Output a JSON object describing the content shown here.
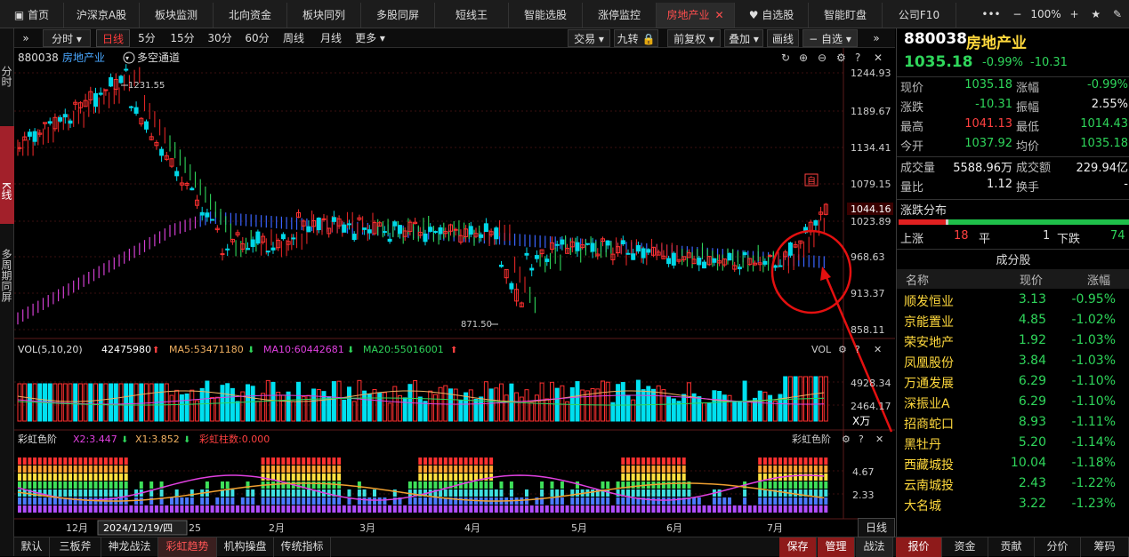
{
  "nav": {
    "tabs": [
      "首页",
      "沪深京A股",
      "板块监测",
      "北向资金",
      "板块同列",
      "多股同屏",
      "短线王",
      "智能选股",
      "涨停监控",
      "房地产业",
      "自选股",
      "智能盯盘",
      "公司F10"
    ],
    "active": "房地产业",
    "zoom": "100%"
  },
  "left_bar": {
    "items": [
      "分时",
      "K线",
      "多周期同屏"
    ]
  },
  "toolbar": {
    "left": [
      "分时",
      "日线",
      "5分",
      "15分",
      "30分",
      "60分",
      "周线",
      "月线",
      "更多"
    ],
    "active": "日线",
    "right": [
      "交易",
      "九转",
      "前复权",
      "叠加",
      "画线",
      "自选"
    ]
  },
  "chart_header": {
    "code": "880038",
    "name": "房地产业",
    "indicator": "多空通道"
  },
  "price_axis": [
    "1244.93",
    "1189.67",
    "1134.41",
    "1079.15",
    "1023.89",
    "968.63",
    "913.37",
    "858.11"
  ],
  "current_price_tag": "1044.16",
  "annotations": {
    "high": "1231.55",
    "low": "871.50",
    "marker": "自"
  },
  "volume": {
    "title": "VOL(5,10,20)",
    "value": "42475980",
    "ma5": "MA5:53471180",
    "ma10": "MA10:60442681",
    "ma20": "MA20:55016001",
    "label": "VOL",
    "axis": [
      "4928.34",
      "2464.17"
    ],
    "unit": "X万"
  },
  "rainbow": {
    "title": "彩虹色阶",
    "x2": "X2:3.447",
    "x1": "X1:3.852",
    "count": "彩虹柱数:0.000",
    "label": "彩虹色阶",
    "axis": [
      "4.67",
      "2.33"
    ]
  },
  "x_axis": {
    "labels": [
      "12月",
      "2月",
      "3月",
      "4月",
      "5月",
      "6月",
      "7月"
    ],
    "cursor": "2024/12/19/四",
    "cursor_tail": "25"
  },
  "bottom_tabs": [
    "默认",
    "三板斧",
    "神龙战法",
    "彩虹趋势",
    "机构操盘",
    "传统指标"
  ],
  "bottom_active": "彩虹趋势",
  "bottom_right": [
    "保存",
    "管理",
    "战法",
    "日线"
  ],
  "quote": {
    "code": "880038",
    "name": "房地产业",
    "price": "1035.18",
    "change_pct": "-0.99%",
    "change": "-10.31",
    "rows": [
      {
        "l1": "现价",
        "v1": "1035.18",
        "l2": "涨幅",
        "v2": "-0.99%"
      },
      {
        "l1": "涨跌",
        "v1": "-10.31",
        "l2": "振幅",
        "v2": "2.55%"
      },
      {
        "l1": "最高",
        "v1": "1041.13",
        "l2": "最低",
        "v2": "1014.43"
      },
      {
        "l1": "今开",
        "v1": "1037.92",
        "l2": "均价",
        "v2": "1035.18"
      }
    ],
    "rows2": [
      {
        "l1": "成交量",
        "v1": "5588.96万",
        "l2": "成交额",
        "v2": "229.94亿"
      },
      {
        "l1": "量比",
        "v1": "1.12",
        "l2": "换手",
        "v2": "-"
      }
    ],
    "distribution": {
      "title": "涨跌分布",
      "up_label": "上涨",
      "up": "18",
      "flat_label": "平",
      "flat": "1",
      "down_label": "下跌",
      "down": "74"
    },
    "constituents_title": "成分股",
    "headers": [
      "名称",
      "现价",
      "涨幅"
    ],
    "stocks": [
      {
        "name": "顺发恒业",
        "price": "3.13",
        "pct": "-0.95%"
      },
      {
        "name": "京能置业",
        "price": "4.85",
        "pct": "-1.02%"
      },
      {
        "name": "荣安地产",
        "price": "1.92",
        "pct": "-1.03%"
      },
      {
        "name": "凤凰股份",
        "price": "3.84",
        "pct": "-1.03%"
      },
      {
        "name": "万通发展",
        "price": "6.29",
        "pct": "-1.10%"
      },
      {
        "name": "深振业A",
        "price": "6.29",
        "pct": "-1.10%"
      },
      {
        "name": "招商蛇口",
        "price": "8.93",
        "pct": "-1.11%"
      },
      {
        "name": "黑牡丹",
        "price": "5.20",
        "pct": "-1.14%"
      },
      {
        "name": "西藏城投",
        "price": "10.04",
        "pct": "-1.18%"
      },
      {
        "name": "云南城投",
        "price": "2.43",
        "pct": "-1.22%"
      },
      {
        "name": "大名城",
        "price": "3.22",
        "pct": "-1.23%"
      }
    ],
    "bottom_tabs": [
      "报价",
      "资金",
      "贡献",
      "分价",
      "筹码"
    ],
    "bottom_active": "报价"
  }
}
